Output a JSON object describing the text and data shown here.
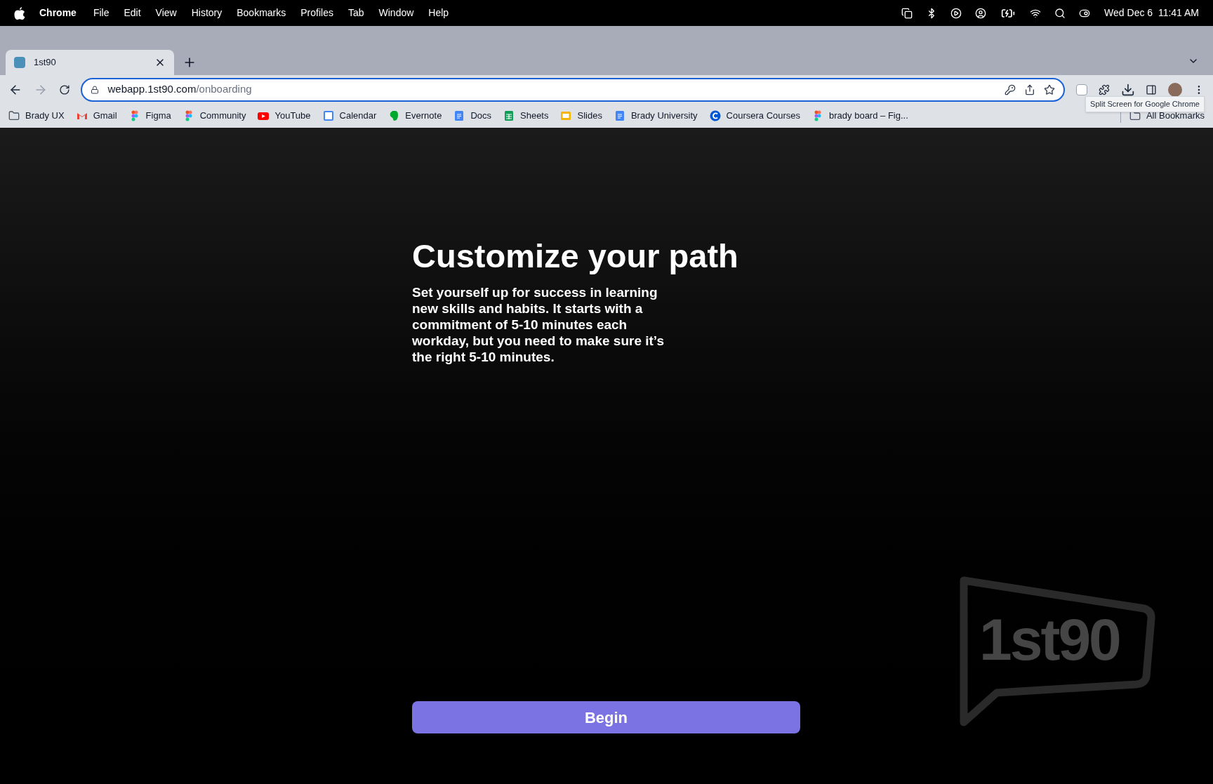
{
  "menu_bar": {
    "app": "Chrome",
    "items": [
      "File",
      "Edit",
      "View",
      "History",
      "Bookmarks",
      "Profiles",
      "Tab",
      "Window",
      "Help"
    ],
    "clock": "Wed Dec 6  11:41 AM"
  },
  "tabs": [
    {
      "title": "1st90",
      "selected": true
    }
  ],
  "address_bar": {
    "host": "webapp.1st90.com",
    "path": "/onboarding"
  },
  "tooltip": "Split Screen for Google Chrome",
  "bookmarks": [
    {
      "label": "Brady UX",
      "kind": "folder"
    },
    {
      "label": "Gmail",
      "kind": "gmail"
    },
    {
      "label": "Figma",
      "kind": "figma"
    },
    {
      "label": "Community",
      "kind": "figma"
    },
    {
      "label": "YouTube",
      "kind": "youtube"
    },
    {
      "label": "Calendar",
      "kind": "calendar"
    },
    {
      "label": "Evernote",
      "kind": "evernote"
    },
    {
      "label": "Docs",
      "kind": "docs"
    },
    {
      "label": "Sheets",
      "kind": "sheets"
    },
    {
      "label": "Slides",
      "kind": "slides"
    },
    {
      "label": "Brady University",
      "kind": "docs"
    },
    {
      "label": "Coursera Courses",
      "kind": "coursera"
    },
    {
      "label": "brady board – Fig...",
      "kind": "figma"
    }
  ],
  "all_bookmarks": "All Bookmarks",
  "page": {
    "heading": "Customize your path",
    "body": "Set yourself up for success in learning new skills and habits. It starts with a commitment of 5-10 minutes each workday, but you need to make sure it’s the right 5-10 minutes.",
    "button": "Begin",
    "logo_text": "1st90"
  }
}
